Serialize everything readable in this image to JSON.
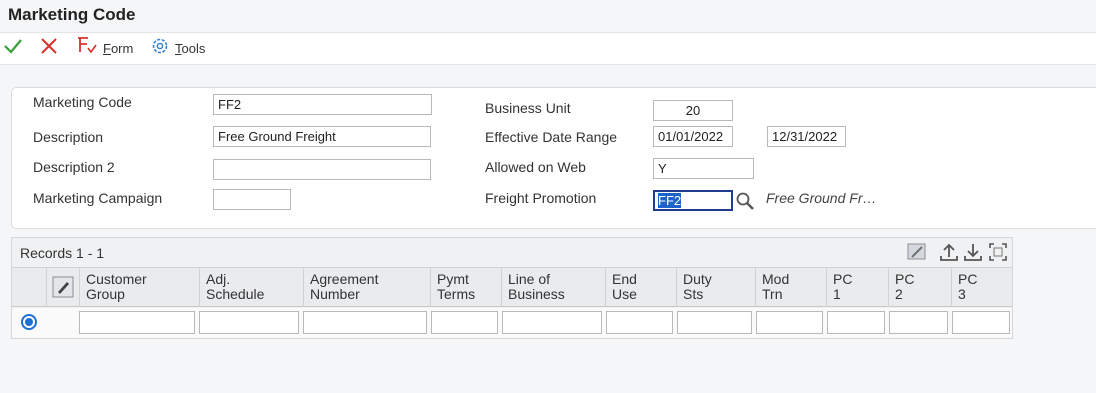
{
  "window": {
    "title": "Marketing Code"
  },
  "toolbar": {
    "ok_icon": "check-icon",
    "cancel_icon": "close-icon",
    "form_label_u": "F",
    "form_label_rest": "orm",
    "tools_label_u": "T",
    "tools_label_rest": "ools"
  },
  "form": {
    "marketing_code": {
      "label": "Marketing Code",
      "value": "FF2"
    },
    "description": {
      "label": "Description",
      "value": "Free Ground Freight"
    },
    "description2": {
      "label": "Description 2",
      "value": ""
    },
    "marketing_campaign": {
      "label": "Marketing Campaign",
      "value": ""
    },
    "business_unit": {
      "label": "Business Unit",
      "value": "20"
    },
    "effective_date_range": {
      "label": "Effective Date Range",
      "from": "01/01/2022",
      "to": "12/31/2022"
    },
    "allowed_on_web": {
      "label": "Allowed on Web",
      "value": "Y"
    },
    "freight_promotion": {
      "label": "Freight Promotion",
      "value": "FF2",
      "description": "Free Ground Fr…"
    }
  },
  "grid": {
    "records_label": "Records 1 - 1",
    "columns": [
      {
        "line1": "Customer",
        "line2": "Group"
      },
      {
        "line1": "Adj.",
        "line2": "Schedule"
      },
      {
        "line1": "Agreement",
        "line2": "Number"
      },
      {
        "line1": "Pymt",
        "line2": "Terms"
      },
      {
        "line1": "Line of",
        "line2": "Business"
      },
      {
        "line1": "End",
        "line2": "Use"
      },
      {
        "line1": "Duty",
        "line2": "Sts"
      },
      {
        "line1": "Mod",
        "line2": "Trn"
      },
      {
        "line1": "PC",
        "line2": "1"
      },
      {
        "line1": "PC",
        "line2": "2"
      },
      {
        "line1": "PC",
        "line2": "3"
      }
    ],
    "rows": [
      {
        "selected": true,
        "cells": [
          "",
          "",
          "",
          "",
          "",
          "",
          "",
          "",
          "",
          "",
          ""
        ]
      }
    ]
  },
  "colors": {
    "accent": "#1a6fd4",
    "ok_green": "#3a9d3a",
    "cancel_red": "#d9302b"
  }
}
